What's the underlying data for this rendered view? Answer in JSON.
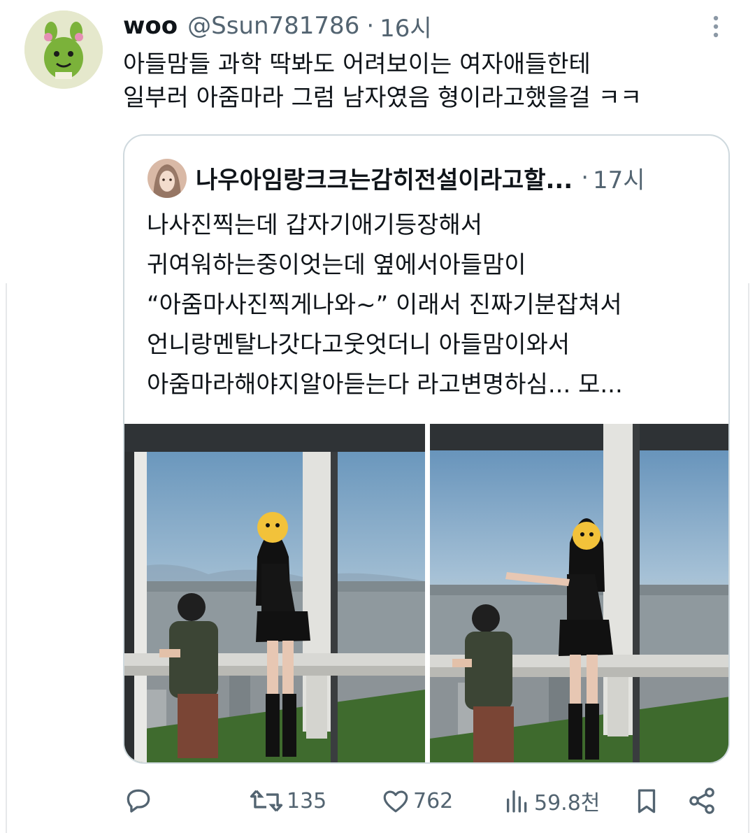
{
  "tweet": {
    "author_name": "woo",
    "handle": "@Ssun781786",
    "separator": "·",
    "time": "16시",
    "text_lines": [
      "아들맘들 과학 딱봐도 어려보이는 여자애들한테",
      "일부러 아줌마라 그럼 남자였음 형이라고했을걸 ㅋㅋ"
    ]
  },
  "quote": {
    "author_name": "나우아임랑크크는감히전설이라고할...",
    "separator": "·",
    "time": "17시",
    "text_lines": [
      "나사진찍는데 갑자기애기등장해서",
      "귀여워하는중이엇는데 옆에서아들맘이",
      "“아줌마사진찍게나와~” 이래서 진짜기분잡쳐서",
      "언니랑멘탈나갓다고웃엇더니 아들맘이와서",
      "아줌마라해야지알아듣는다 라고변명하심... 모..."
    ]
  },
  "actions": {
    "replies": "",
    "retweets": "135",
    "likes": "762",
    "views": "59.8천"
  },
  "icons": [
    "more-icon",
    "reply-icon",
    "retweet-icon",
    "like-icon",
    "views-icon",
    "bookmark-icon",
    "share-icon"
  ],
  "colors": {
    "muted": "#536471",
    "border": "#cfd9de",
    "text": "#0f1419"
  }
}
